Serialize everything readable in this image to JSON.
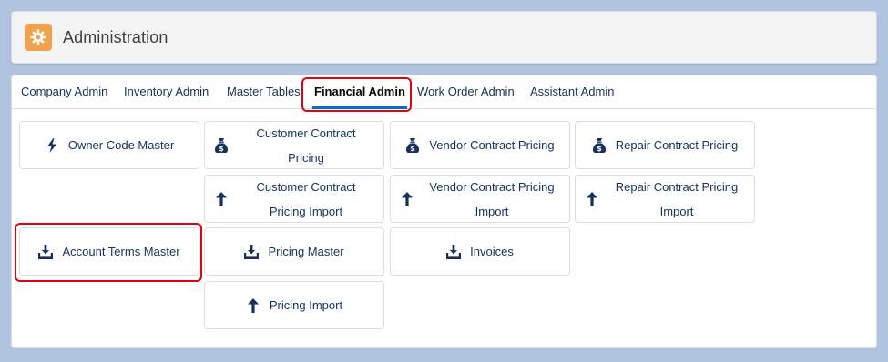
{
  "header": {
    "title": "Administration",
    "icon": "gear-icon",
    "icon_color": "#f0a24f"
  },
  "tabs": [
    {
      "label": "Company Admin"
    },
    {
      "label": "Inventory Admin"
    },
    {
      "label": "Master Tables"
    },
    {
      "label": "Financial Admin",
      "active": true
    },
    {
      "label": "Work Order Admin"
    },
    {
      "label": "Assistant Admin"
    }
  ],
  "tiles": [
    {
      "label": "Owner Code Master",
      "icon": "lightning-icon"
    },
    {
      "label": "Customer Contract Pricing",
      "icon": "money-bag-icon"
    },
    {
      "label": "Vendor Contract Pricing",
      "icon": "money-bag-icon"
    },
    {
      "label": "Repair Contract Pricing",
      "icon": "money-bag-icon"
    },
    {
      "label": "Customer Contract Pricing Import",
      "icon": "arrow-up-icon"
    },
    {
      "label": "Vendor Contract Pricing Import",
      "icon": "arrow-up-icon"
    },
    {
      "label": "Repair Contract Pricing Import",
      "icon": "arrow-up-icon"
    },
    {
      "label": "Account Terms Master",
      "icon": "download-tray-icon"
    },
    {
      "label": "Pricing Master",
      "icon": "download-tray-icon"
    },
    {
      "label": "Invoices",
      "icon": "download-tray-icon"
    },
    {
      "label": "Pricing Import",
      "icon": "arrow-up-icon"
    }
  ],
  "colors": {
    "accent": "#0070d2",
    "highlight": "#e3000f",
    "text": "#16325c",
    "background": "#b0c4df"
  }
}
